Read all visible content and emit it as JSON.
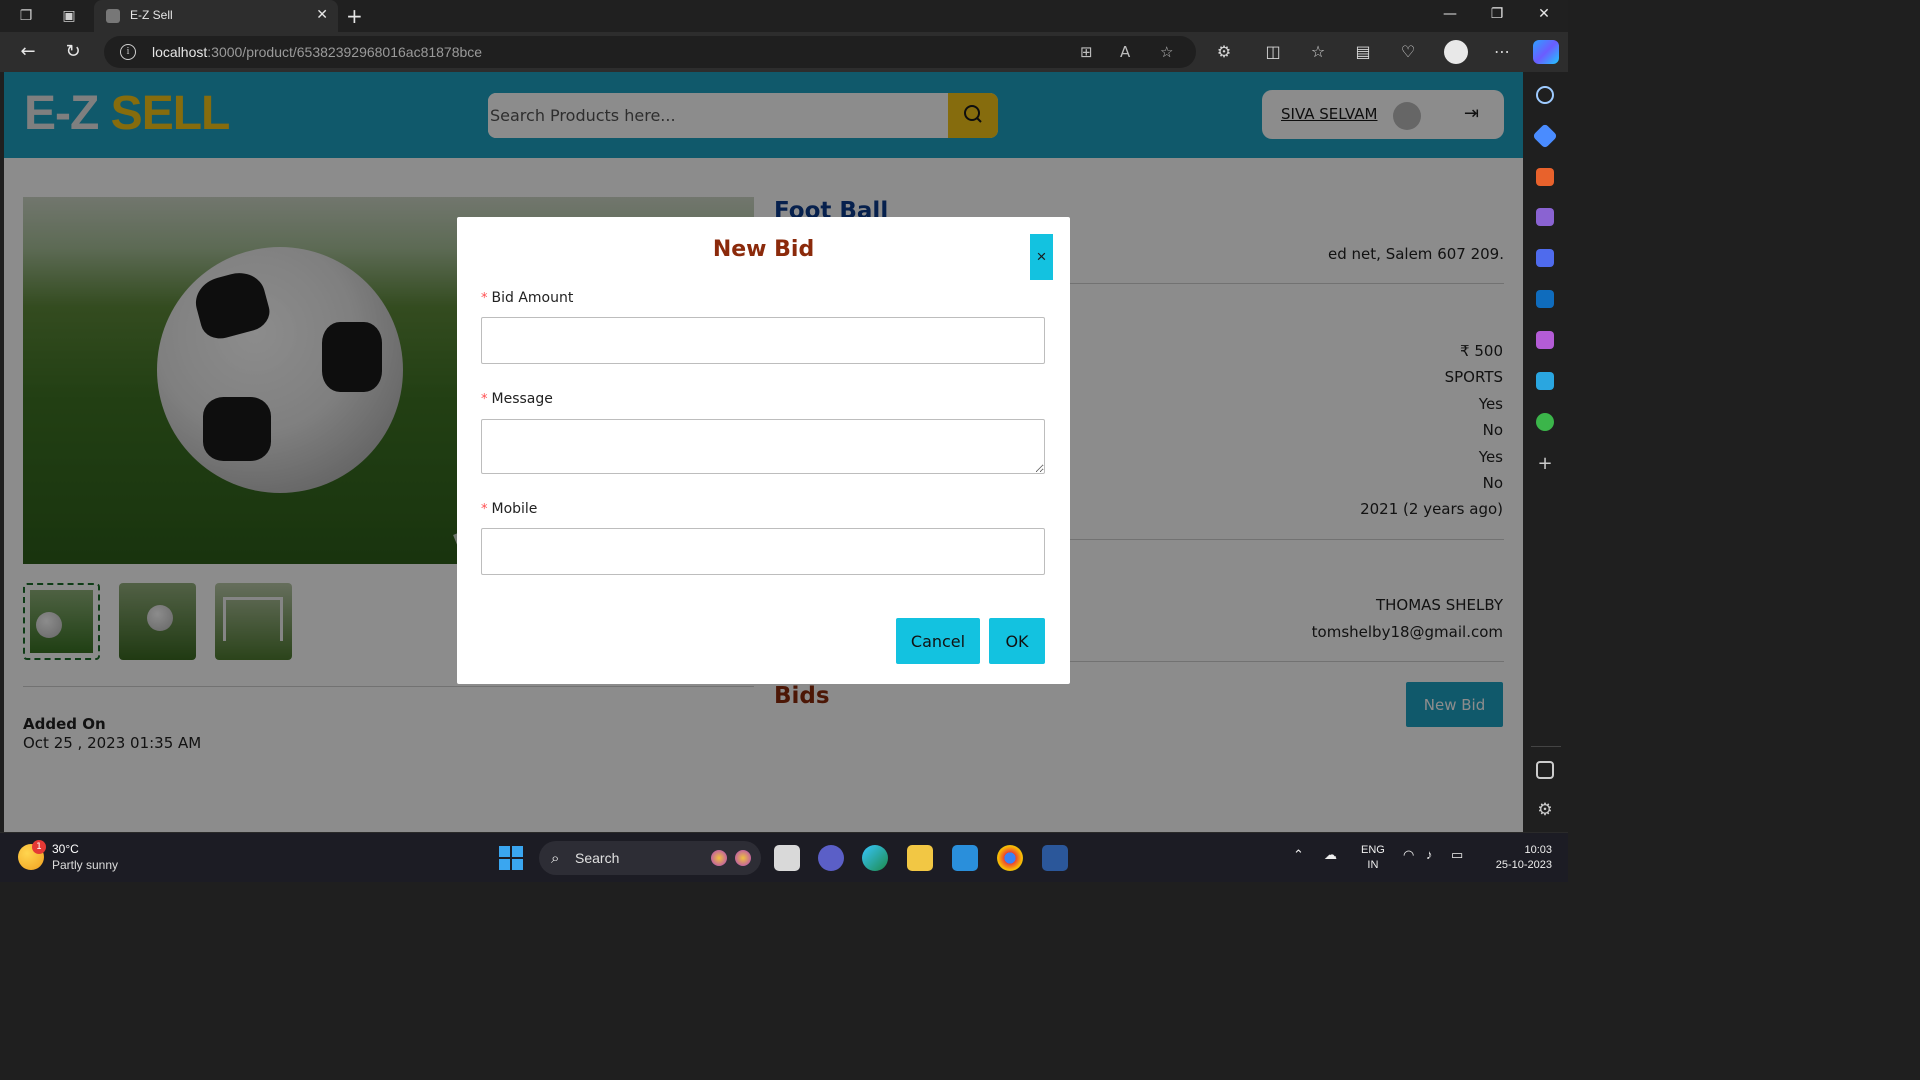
{
  "browser": {
    "tab_title": "E-Z Sell",
    "url_host": "localhost",
    "url_path": ":3000/product/65382392968016ac81878bce"
  },
  "app": {
    "logo_part1": "E-Z",
    "logo_part2": "SELL",
    "search_placeholder": "Search Products here...",
    "user_name": "SIVA SELVAM"
  },
  "product": {
    "title": "Foot Ball",
    "address_fragment": "ed net, Salem 607 209.",
    "details": [
      "₹ 500",
      "SPORTS",
      "Yes",
      "No",
      "Yes",
      "No",
      "2021 (2 years ago)"
    ],
    "seller_name": "THOMAS SHELBY",
    "seller_email": "tomshelby18@gmail.com",
    "added_on_label": "Added On",
    "added_on_value": "Oct 25 , 2023 01:35 AM",
    "bids_heading": "Bids",
    "new_bid_button": "New Bid"
  },
  "modal": {
    "title": "New Bid",
    "close_symbol": "×",
    "required_mark": "*",
    "fields": [
      {
        "label": "Bid Amount",
        "value": ""
      },
      {
        "label": "Message",
        "value": ""
      },
      {
        "label": "Mobile",
        "value": ""
      }
    ],
    "cancel_label": "Cancel",
    "ok_label": "OK"
  },
  "taskbar": {
    "weather_temp": "30°C",
    "weather_desc": "Partly sunny",
    "weather_badge": "1",
    "search_label": "Search",
    "lang_line1": "ENG",
    "lang_line2": "IN",
    "time": "10:03",
    "date": "25-10-2023"
  },
  "colors": {
    "header_bg": "#1ea3c4",
    "logo_accent": "#f5c518",
    "modal_button": "#13c2e0",
    "modal_title": "#8b2a0b",
    "product_title": "#0b3b8c"
  }
}
